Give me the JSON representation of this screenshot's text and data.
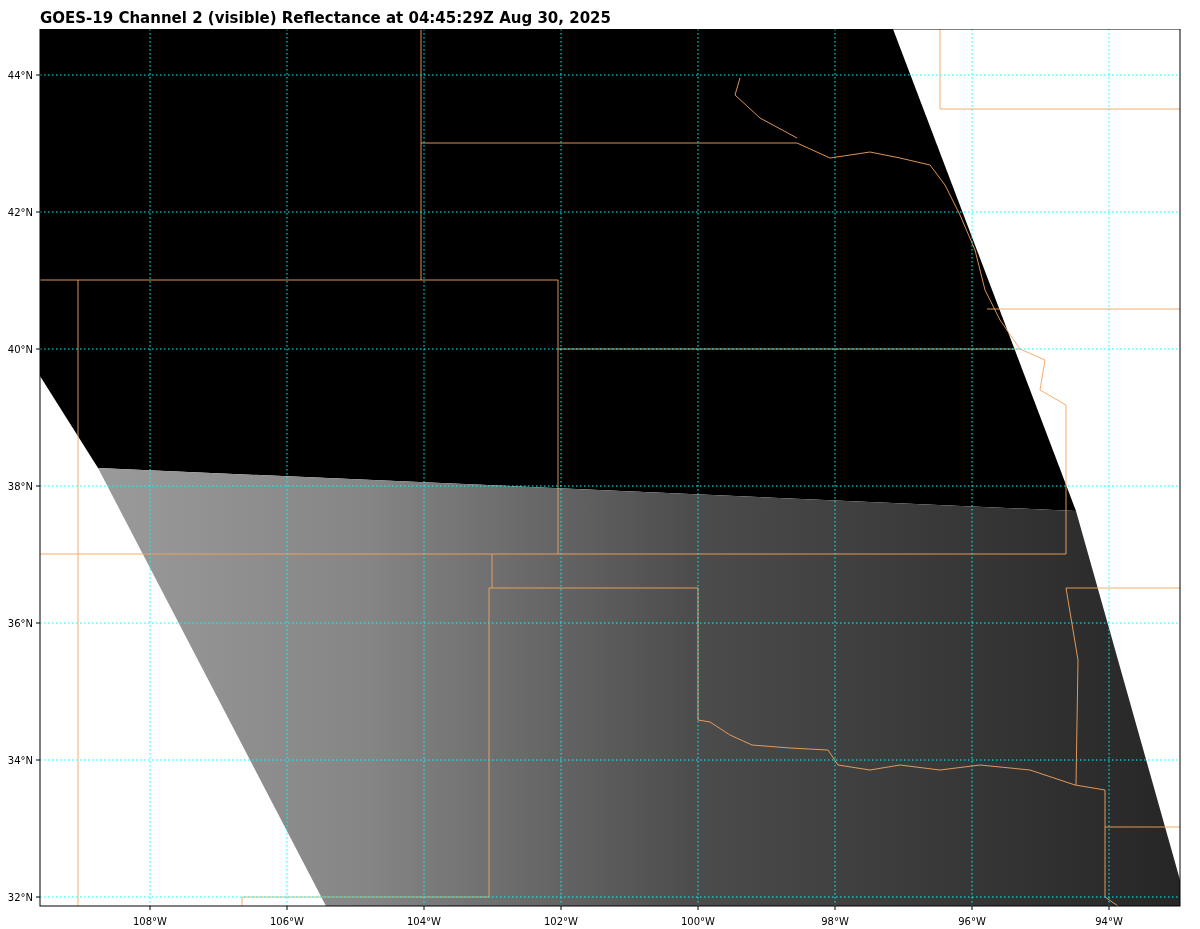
{
  "title": "GOES-19 Channel 2 (visible) Reflectance at 04:45:29Z Aug 30, 2025",
  "map": {
    "latitude_labels": [
      "44°N",
      "42°N",
      "40°N",
      "38°N",
      "36°N",
      "34°N",
      "32°N"
    ],
    "longitude_labels": [
      "108°W",
      "106°W",
      "104°W",
      "102°W",
      "100°W",
      "98°W",
      "96°W",
      "94°W"
    ]
  }
}
